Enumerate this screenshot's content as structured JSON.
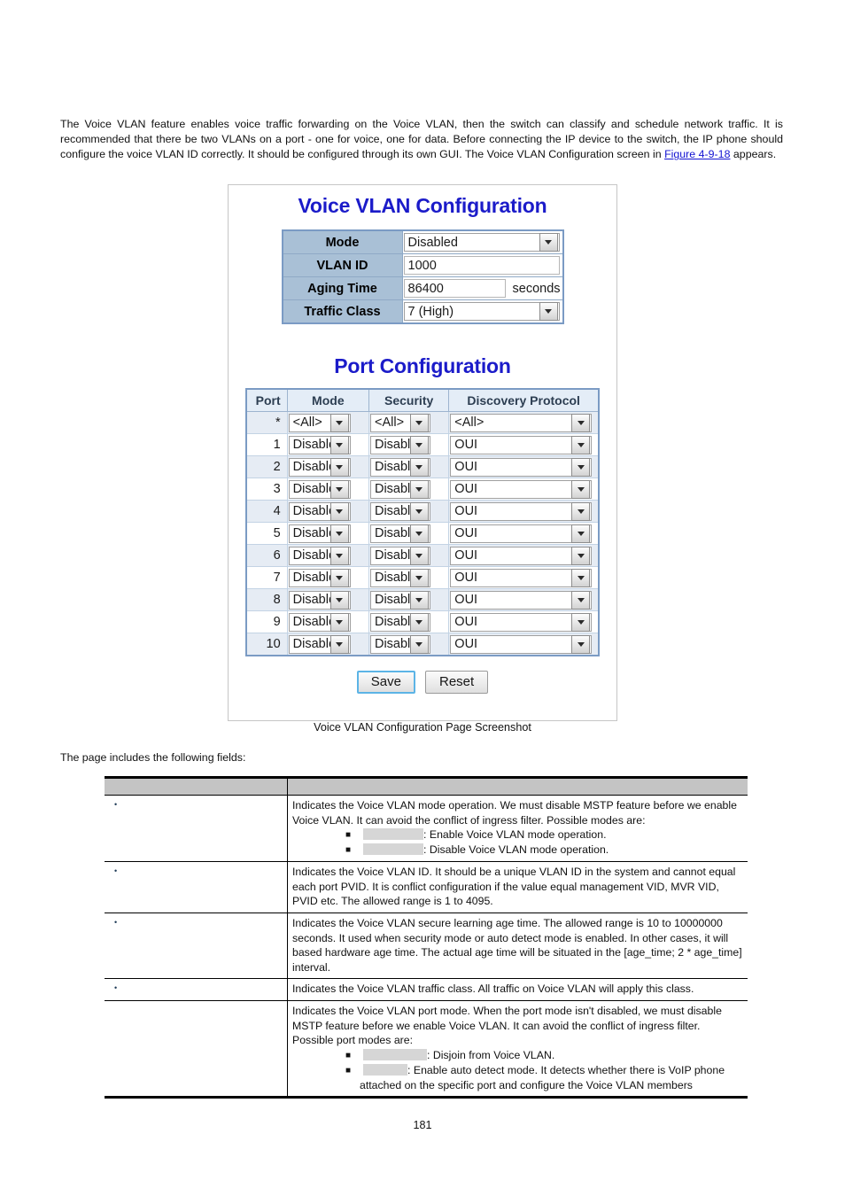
{
  "document": {
    "page_number": "181",
    "intro_paragraph_part1": "The Voice VLAN feature enables voice traffic forwarding on the Voice VLAN, then the switch can classify and schedule network traffic. It is recommended that there be two VLANs on a port - one for voice, one for data. Before connecting the IP device to the switch, the IP phone should configure the voice VLAN ID correctly. It should be configured through its own GUI. The Voice VLAN Configuration screen in ",
    "figure_link": "Figure 4-9-18",
    "intro_paragraph_part2": " appears.",
    "figure_caption": "Voice VLAN Configuration Page Screenshot",
    "lead_in": "The page includes the following fields:",
    "link_color": "#1414d2"
  },
  "screenshot": {
    "global_title": "Voice VLAN Configuration",
    "port_title": "Port Configuration",
    "global_fields": [
      {
        "label": "Mode",
        "control": "select",
        "value": "Disabled",
        "unit": ""
      },
      {
        "label": "VLAN ID",
        "control": "text",
        "value": "1000",
        "unit": ""
      },
      {
        "label": "Aging Time",
        "control": "text",
        "value": "86400",
        "unit": "seconds"
      },
      {
        "label": "Traffic Class",
        "control": "select",
        "value": "7 (High)",
        "unit": ""
      }
    ],
    "port_table": {
      "headers": [
        "Port",
        "Mode",
        "Security",
        "Discovery Protocol"
      ],
      "rows": [
        {
          "port": "*",
          "mode": "<All>",
          "security": "<All>",
          "discovery": "<All>"
        },
        {
          "port": "1",
          "mode": "Disabled",
          "security": "Disabled",
          "discovery": "OUI"
        },
        {
          "port": "2",
          "mode": "Disabled",
          "security": "Disabled",
          "discovery": "OUI"
        },
        {
          "port": "3",
          "mode": "Disabled",
          "security": "Disabled",
          "discovery": "OUI"
        },
        {
          "port": "4",
          "mode": "Disabled",
          "security": "Disabled",
          "discovery": "OUI"
        },
        {
          "port": "5",
          "mode": "Disabled",
          "security": "Disabled",
          "discovery": "OUI"
        },
        {
          "port": "6",
          "mode": "Disabled",
          "security": "Disabled",
          "discovery": "OUI"
        },
        {
          "port": "7",
          "mode": "Disabled",
          "security": "Disabled",
          "discovery": "OUI"
        },
        {
          "port": "8",
          "mode": "Disabled",
          "security": "Disabled",
          "discovery": "OUI"
        },
        {
          "port": "9",
          "mode": "Disabled",
          "security": "Disabled",
          "discovery": "OUI"
        },
        {
          "port": "10",
          "mode": "Disabled",
          "security": "Disabled",
          "discovery": "OUI"
        }
      ]
    },
    "buttons": {
      "save": "Save",
      "reset": "Reset"
    },
    "colors": {
      "title_blue": "#1b1bc9",
      "label_cell": "#a9c0d6",
      "table_border": "#7b9bc4",
      "header_row": "#e4edf7",
      "alt_row": "#e6ecf4"
    }
  },
  "field_table": {
    "header": {
      "col1": "",
      "col2": ""
    },
    "rows": [
      {
        "label": "",
        "bullet": "•",
        "body": "Indicates the Voice VLAN mode operation. We must disable MSTP feature before we enable Voice VLAN. It can avoid the conflict of ingress filter. Possible modes are:",
        "sub_items": [
          {
            "marker": "■",
            "term": "",
            "term_width": 68,
            "text": ": Enable Voice VLAN mode operation."
          },
          {
            "marker": "■",
            "term": "",
            "term_width": 68,
            "text": ": Disable Voice VLAN mode operation."
          }
        ],
        "continuation": ""
      },
      {
        "label": "",
        "bullet": "•",
        "body": "Indicates the Voice VLAN ID. It should be a unique VLAN ID in the system and cannot equal each port PVID. It is conflict configuration if the value equal management VID, MVR VID, PVID etc. The allowed range is 1 to 4095.",
        "sub_items": [],
        "continuation": ""
      },
      {
        "label": "",
        "bullet": "•",
        "body": "Indicates the Voice VLAN secure learning age time. The allowed range is 10 to 10000000 seconds. It used when security mode or auto detect mode is enabled. In other cases, it will based hardware age time. The actual age time will be situated in the [age_time; 2 * age_time] interval.",
        "sub_items": [],
        "continuation": ""
      },
      {
        "label": "",
        "bullet": "•",
        "body": "Indicates the Voice VLAN traffic class. All traffic on Voice VLAN will apply this class.",
        "sub_items": [],
        "continuation": ""
      },
      {
        "label": "",
        "bullet": "",
        "body": "Indicates the Voice VLAN port mode. When the port mode isn't disabled, we must disable MSTP feature before we enable Voice VLAN. It can avoid the conflict of ingress filter. Possible port modes are:",
        "sub_items": [
          {
            "marker": "■",
            "term": "",
            "term_width": 72,
            "text": ": Disjoin from Voice VLAN."
          },
          {
            "marker": "■",
            "term": "",
            "term_width": 50,
            "text": ": Enable auto detect mode. It detects whether there is VoIP phone"
          }
        ],
        "continuation": "attached on the specific port and configure the Voice VLAN members"
      }
    ]
  }
}
